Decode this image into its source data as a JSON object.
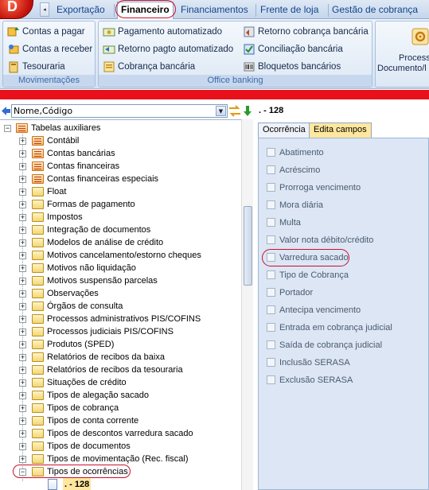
{
  "app": {
    "logo_letter": "D",
    "qa_arrow": "◂"
  },
  "ribbon_tabs": [
    {
      "label": "Exportação"
    },
    {
      "label": "Financeiro"
    },
    {
      "label": "Financiamentos"
    },
    {
      "label": "Frente de loja"
    },
    {
      "label": "Gestão de cobrança"
    }
  ],
  "groups": {
    "movimentacoes": {
      "label": "Movimentações",
      "buttons": [
        "Contas a pagar",
        "Contas a receber",
        "Tesouraria"
      ]
    },
    "office_banking": {
      "label": "Office banking",
      "buttons": [
        "Pagamento automatizado",
        "Retorno pagto automatizado",
        "Cobrança bancária",
        "Retorno cobrança bancária",
        "Conciliação bancária",
        "Bloquetos bancários"
      ]
    },
    "process": {
      "line1": "Process",
      "line2": "Documento/l"
    }
  },
  "address": {
    "combo_value": "Nome,Código",
    "title": ". - 128"
  },
  "tree": {
    "root": "Tabelas auxiliares",
    "items": [
      "Contábil",
      "Contas bancárias",
      "Contas financeiras",
      "Contas financeiras especiais",
      "Float",
      "Formas de pagamento",
      "Impostos",
      "Integração de documentos",
      "Modelos de análise de crédito",
      "Motivos cancelamento/estorno cheques",
      "Motivos não liquidação",
      "Motivos suspensão parcelas",
      "Observações",
      "Órgãos de consulta",
      "Processos administrativos PIS/COFINS",
      "Processos judiciais PIS/COFINS",
      "Produtos (SPED)",
      "Relatórios de recibos da baixa",
      "Relatórios de recibos da tesouraria",
      "Situações de crédito",
      "Tipos de alegação sacado",
      "Tipos de cobrança",
      "Tipos de conta corrente",
      "Tipos de descontos varredura sacado",
      "Tipos de documentos",
      "Tipos de movimentação (Rec. fiscal)",
      "Tipos de ocorrências"
    ],
    "child": ". - 128"
  },
  "panel": {
    "tabs": [
      "Ocorrência",
      "Edita campos"
    ],
    "checkboxes": [
      "Abatimento",
      "Acréscimo",
      "Prorroga vencimento",
      "Mora diária",
      "Multa",
      "Valor nota débito/crédito",
      "Varredura sacado",
      "Tipo de Cobrança",
      "Portador",
      "Antecipa vencimento",
      "Entrada em cobrança judicial",
      "Saída de cobrança judicial",
      "Inclusão SERASA",
      "Exclusão SERASA"
    ]
  },
  "colors": {
    "highlight": "#c8102e",
    "ribbon_text": "#15428b",
    "active_tab": "#ffe79e"
  },
  "icons": [
    "contas-pagar-icon",
    "contas-receber-icon",
    "tesouraria-icon",
    "pagamento-icon",
    "retorno-pagto-icon",
    "cobranca-icon",
    "retorno-cobranca-icon",
    "conciliacao-icon",
    "bloquetos-icon",
    "process-icon",
    "back-arrow-icon",
    "swap-icon",
    "down-arrow-icon",
    "folder-icon",
    "document-icon"
  ]
}
